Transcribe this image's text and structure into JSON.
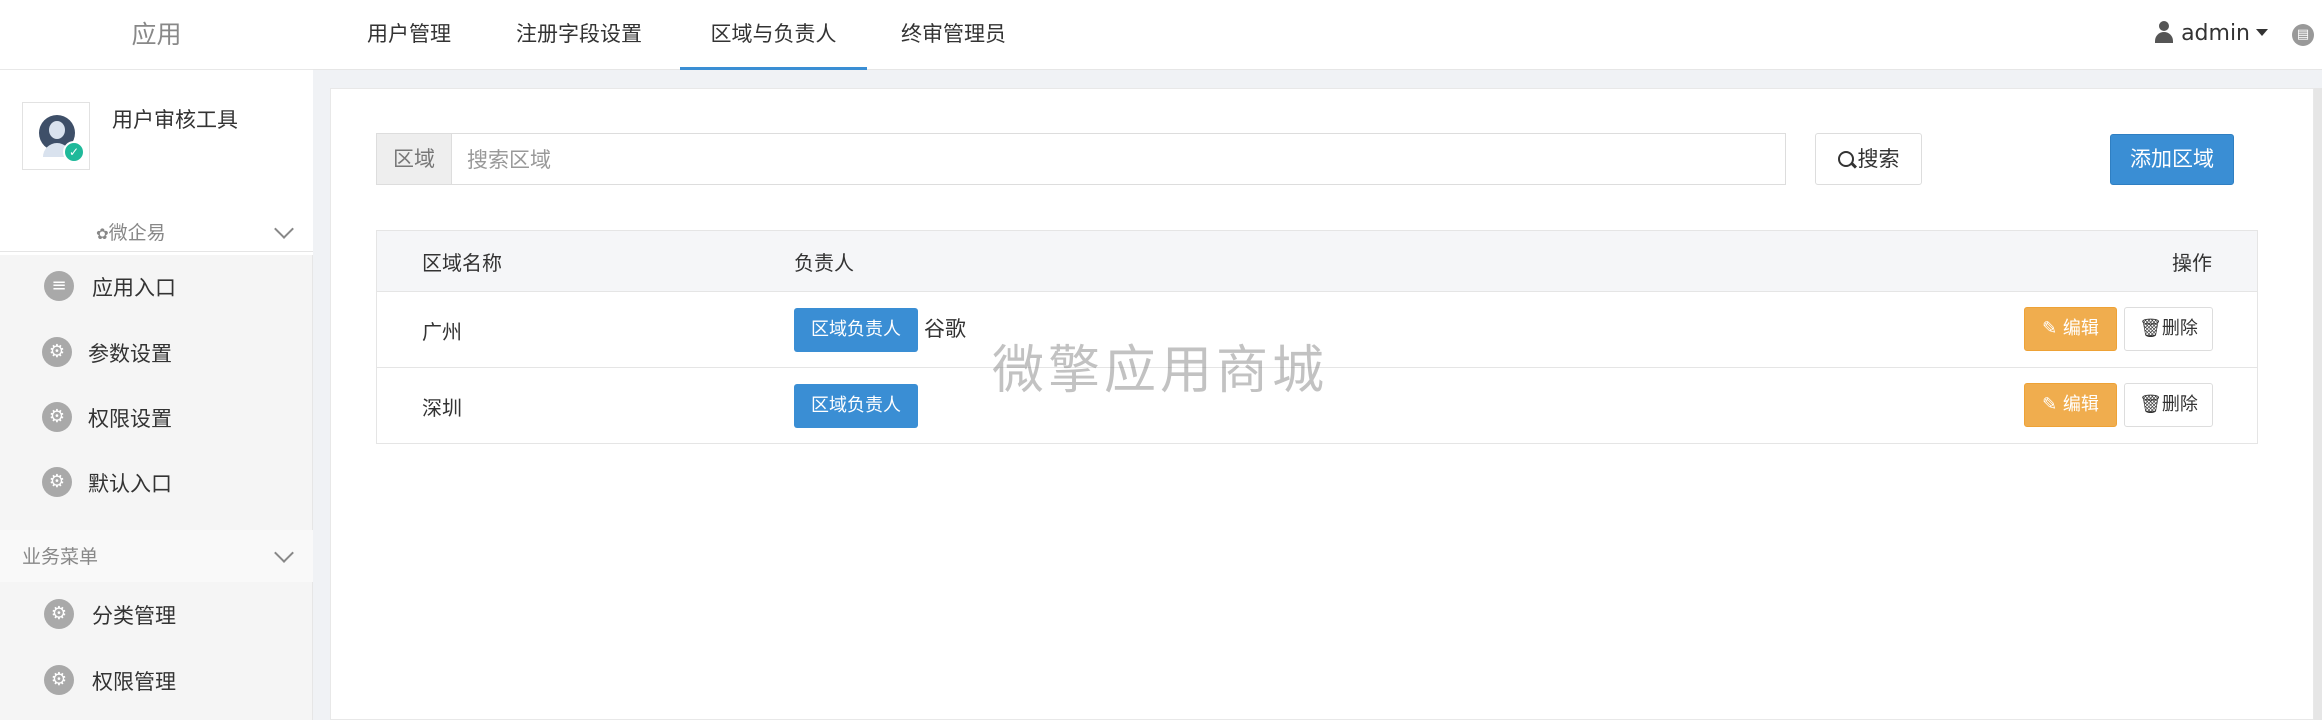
{
  "sidebar": {
    "title": "应用",
    "app_name": "用户审核工具",
    "group1_label": "微企易",
    "group1_icon": "wechat-icon",
    "items_group1": [
      {
        "label": "应用入口",
        "icon": "chat-icon"
      },
      {
        "label": "参数设置",
        "icon": "gear-icon"
      },
      {
        "label": "权限设置",
        "icon": "gear-icon"
      },
      {
        "label": "默认入口",
        "icon": "gear-icon"
      }
    ],
    "group2_label": "业务菜单",
    "items_group2": [
      {
        "label": "分类管理",
        "icon": "gear-icon"
      },
      {
        "label": "权限管理",
        "icon": "gear-icon"
      }
    ]
  },
  "header": {
    "tabs": [
      {
        "label": "用户管理",
        "active": false
      },
      {
        "label": "注册字段设置",
        "active": false
      },
      {
        "label": "区域与负责人",
        "active": true
      },
      {
        "label": "终审管理员",
        "active": false
      }
    ],
    "user_name": "admin"
  },
  "search": {
    "addon_label": "区域",
    "placeholder": "搜索区域",
    "value": "",
    "search_button": "搜索",
    "add_button": "添加区域"
  },
  "table": {
    "headers": [
      "区域名称",
      "负责人",
      "操作"
    ],
    "rows": [
      {
        "name": "广州",
        "owner_button": "区域负责人",
        "owner": "谷歌",
        "edit": "编辑",
        "delete": "删除"
      },
      {
        "name": "深圳",
        "owner_button": "区域负责人",
        "owner": "",
        "edit": "编辑",
        "delete": "删除"
      }
    ]
  },
  "watermark": "微擎应用商城",
  "colors": {
    "accent": "#3a8ed4",
    "warning": "#f0ad4e",
    "sidebar_bg": "#f5f5f5"
  }
}
